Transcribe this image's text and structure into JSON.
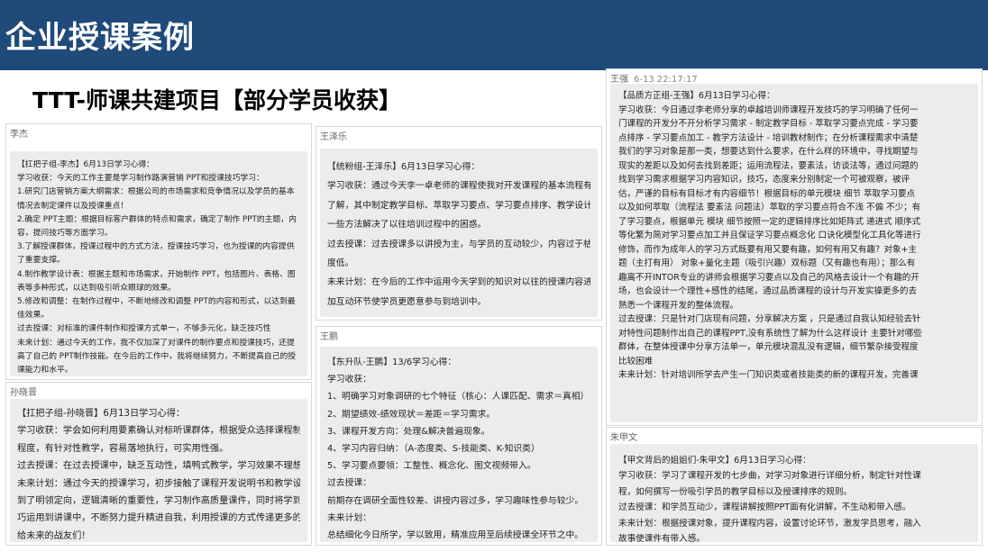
{
  "header": {
    "title": "企业授课案例"
  },
  "subtitle": "TTT-师课共建项目【部分学员收获】",
  "cards": {
    "li": {
      "name": "李杰",
      "lines": [
        "【扛把子组-李杰】6月13日学习心得：",
        "学习收获：今天的工作主要是学习制作路演营销 PPT和授课技巧学习：",
        "1.研究门店营销方案大纲需求：根据公司的市场需求和竞争情况以及学员的基本",
        "情况去制定课件以及授课重点！",
        "2.确定 PPT主题：根据目标客户群体的特点和需求，确定了制作 PPT的主题，内",
        "容，提问技巧等方面学习。",
        "3.了解授课群体，授课过程中的方式方法，授课技巧学习，也为授课的内容提供",
        "了重要支撑。",
        "4.制作教学设计表：根据主题和市场需求，开始制作 PPT，包括图片、表格、图",
        "表等多种形式，以达到吸引听众眼球的效果。",
        "5.修改和调整：在制作过程中，不断地修改和调整 PPT的内容和形式，以达到最",
        "佳效果。",
        "过去授课：对标准的课件制作和授课方式单一，不够多元化，缺乏技巧性",
        "未来计划：通过今天的工作，我不仅加深了对课件的制作要点和授课技巧，还提",
        "高了自己的 PPT制作技能。在今后的工作中，我将继续努力，不断提高自己的授",
        "课能力和水平。"
      ]
    },
    "sun": {
      "name": "孙晓晋",
      "lines": [
        "【扛把子组-孙晓晋】6月13日学习心得：",
        "学习收获：学会如何利用要素确认对标听课群体，根据受众选择课程制定的难易",
        "程度，有针对性教学，容易落地执行，可实用性强。",
        "过去授课：在过去授课中，缺乏互动性，填鸭式教学，学习效果不理想。",
        "未来计划：通过今天的授课学习，初步接触了课程开发说明书和教学设计，感受",
        "到了明领定向，逻辑清晰的重要性，学习制作高质量课件，同时将学到的授课技",
        "巧运用到讲课中，不断努力提升精进自我，利用授课的方式传递更多的行业知识",
        "给未来的战友们！"
      ]
    },
    "wangze": {
      "name": "王泽乐",
      "lines": [
        "【统粉组-王泽乐】6月13日学习心得：",
        "学习收获：通过今天李一卓老师的课程使我对开发课程的基本流程有了更深入的",
        "了解，其中制定教学目标、萃取学习要点、学习要点排序、教学设计板块介绍的",
        "一些方法解决了以往培训过程中的困惑。",
        "过去授课：过去授课多以讲授为主，与学员的互动较少，内容过于枯燥员工参与",
        "度低。",
        "未来计划：在今后的工作中运用今天学到的知识对以往的授课内容进行优化，增",
        "加互动环节使学员更愿意参与到培训中。"
      ]
    },
    "wangp": {
      "name": "王鹏",
      "lines": [
        "【东升队-王鹏】13/6学习心得：",
        "学习收获：",
        "1、明确学习对象调研的七个特征（核心：人课匹配、需求＝真相）",
        "2、期望绩效-绩效现状＝差距＝学习需求。",
        "3、课程开发方向：处理&解决普遍现象。",
        "4、学习内容归纳：（A-态度类、S-技能类、K-知识类）",
        "5、学习要点要领：工整性、概念化、图文视频带入。",
        "过去授课：",
        "前期存在调研全面性较差、讲授内容过多，学习趣味性参与较少。",
        "未来计划：",
        "总结细化今日所学，学以致用，精准应用至后续授课全环节之中。"
      ]
    },
    "wangq": {
      "name": "王强",
      "timestamp": "6-13 22:17:17",
      "lines": [
        "【品质方正组-王强】6月13日学习心得：",
        "学习收获：今日通过李老师分享的卓越培训师课程开发技巧的学习明确了任何一",
        "门课程的开发分不开分析学习需求 - 制定教学目标 - 萃取学习要点完成 - 学习要",
        "点排序 - 学习要点加工 - 教学方法设计 - 培训教材制作；在分析课程需求中清楚",
        "我们的学习对象是那一类，想要达到什么要求，在什么样的环境中，寻找期望与",
        "现实的差距以及如何去找到差距；运用流程法，要素法，访谈法等，通过问题的",
        "找到学习需求根据学习内容知识，技巧，态度来分别制定一个可被观察，被评",
        "估，严谨的目标有目标才有内容细节！根据目标的单元模块 细节 萃取学习要点",
        "以及如何萃取（流程法 要素法 问题法）萃取的学习要点符合不浅 不偏 不少；有",
        "了学习要点，根据单元 模块 细节按照一定的逻辑排序比如矩阵式 递进式 顺序式",
        "等化繁为简对学习要点加工并且保证学习要点概念化 口诀化模型化工具化等进行",
        "修饰，而作为成年人的学习方式既要有用又要有趣，如何有用又有趣？对象+主",
        "题（主打有用） 对象+量化主题（吸引兴趣）双标题（又有趣也有用）；那么有",
        "趣离不开INTOR专业的讲师会根据学习要点以及自己的风格去设计一个有趣的开",
        "场，也会设计一个理性+感性的结尾，通过品质课程的设计与开发实操更多的去",
        "熟悉一个课程开发的整体流程。",
        "过去授课：只是针对门店现有问题，分享解决方案 ，只是通过自我认知经验去针",
        "对特性问题制作出自己的课程PPT,没有系统性了解为什么这样设计 主要针对哪些",
        "群体，在整体授课中分享方法单一，单元模块混乱没有逻辑，细节繁杂接受程度",
        "比较困难",
        "未来计划：针对培训所学去产生一门知识类或者技能类的新的课程开发，完善课"
      ]
    },
    "zhu": {
      "name": "朱甲文",
      "lines": [
        "【甲文背后的姐姐们-朱甲文】6月13日学习心得：",
        "学习收获：学习了课程开发的七步曲，对学习对象进行详细分析，制定针对性课",
        "程，如何撰写一份吸引学员的教学目标以及授课排序的规则。",
        "过去授课：和学员互动少，课程讲解按照PPT面有化讲解，不生动和带入感。",
        "未来计划：根据授课对象，提升课程内容，设置讨论环节，激发学员思考，融入",
        "故事使课件有带入感。"
      ]
    }
  }
}
